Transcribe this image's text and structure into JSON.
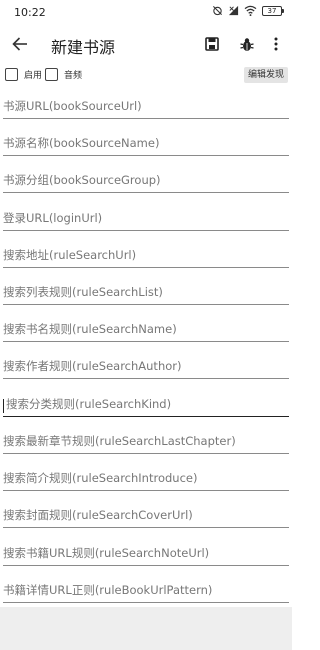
{
  "status_bar": {
    "time": "10:22",
    "battery": "37"
  },
  "app_bar": {
    "title": "新建书源",
    "back_icon": "arrow-left-icon",
    "save_icon": "save-icon",
    "debug_icon": "bug-icon",
    "more_icon": "more-vert-icon"
  },
  "options": {
    "enable_label": "启用",
    "audio_label": "音频",
    "edit_discover_label": "编辑发现"
  },
  "fields": [
    {
      "placeholder": "书源URL(bookSourceUrl)"
    },
    {
      "placeholder": "书源名称(bookSourceName)"
    },
    {
      "placeholder": "书源分组(bookSourceGroup)"
    },
    {
      "placeholder": "登录URL(loginUrl)"
    },
    {
      "placeholder": "搜索地址(ruleSearchUrl)"
    },
    {
      "placeholder": "搜索列表规则(ruleSearchList)"
    },
    {
      "placeholder": "搜索书名规则(ruleSearchName)"
    },
    {
      "placeholder": "搜索作者规则(ruleSearchAuthor)"
    },
    {
      "placeholder": "搜索分类规则(ruleSearchKind)"
    },
    {
      "placeholder": "搜索最新章节规则(ruleSearchLastChapter)"
    },
    {
      "placeholder": "搜索简介规则(ruleSearchIntroduce)"
    },
    {
      "placeholder": "搜索封面规则(ruleSearchCoverUrl)"
    },
    {
      "placeholder": "搜索书籍URL规则(ruleSearchNoteUrl)"
    },
    {
      "placeholder": "书籍详情URL正则(ruleBookUrlPattern)"
    }
  ]
}
